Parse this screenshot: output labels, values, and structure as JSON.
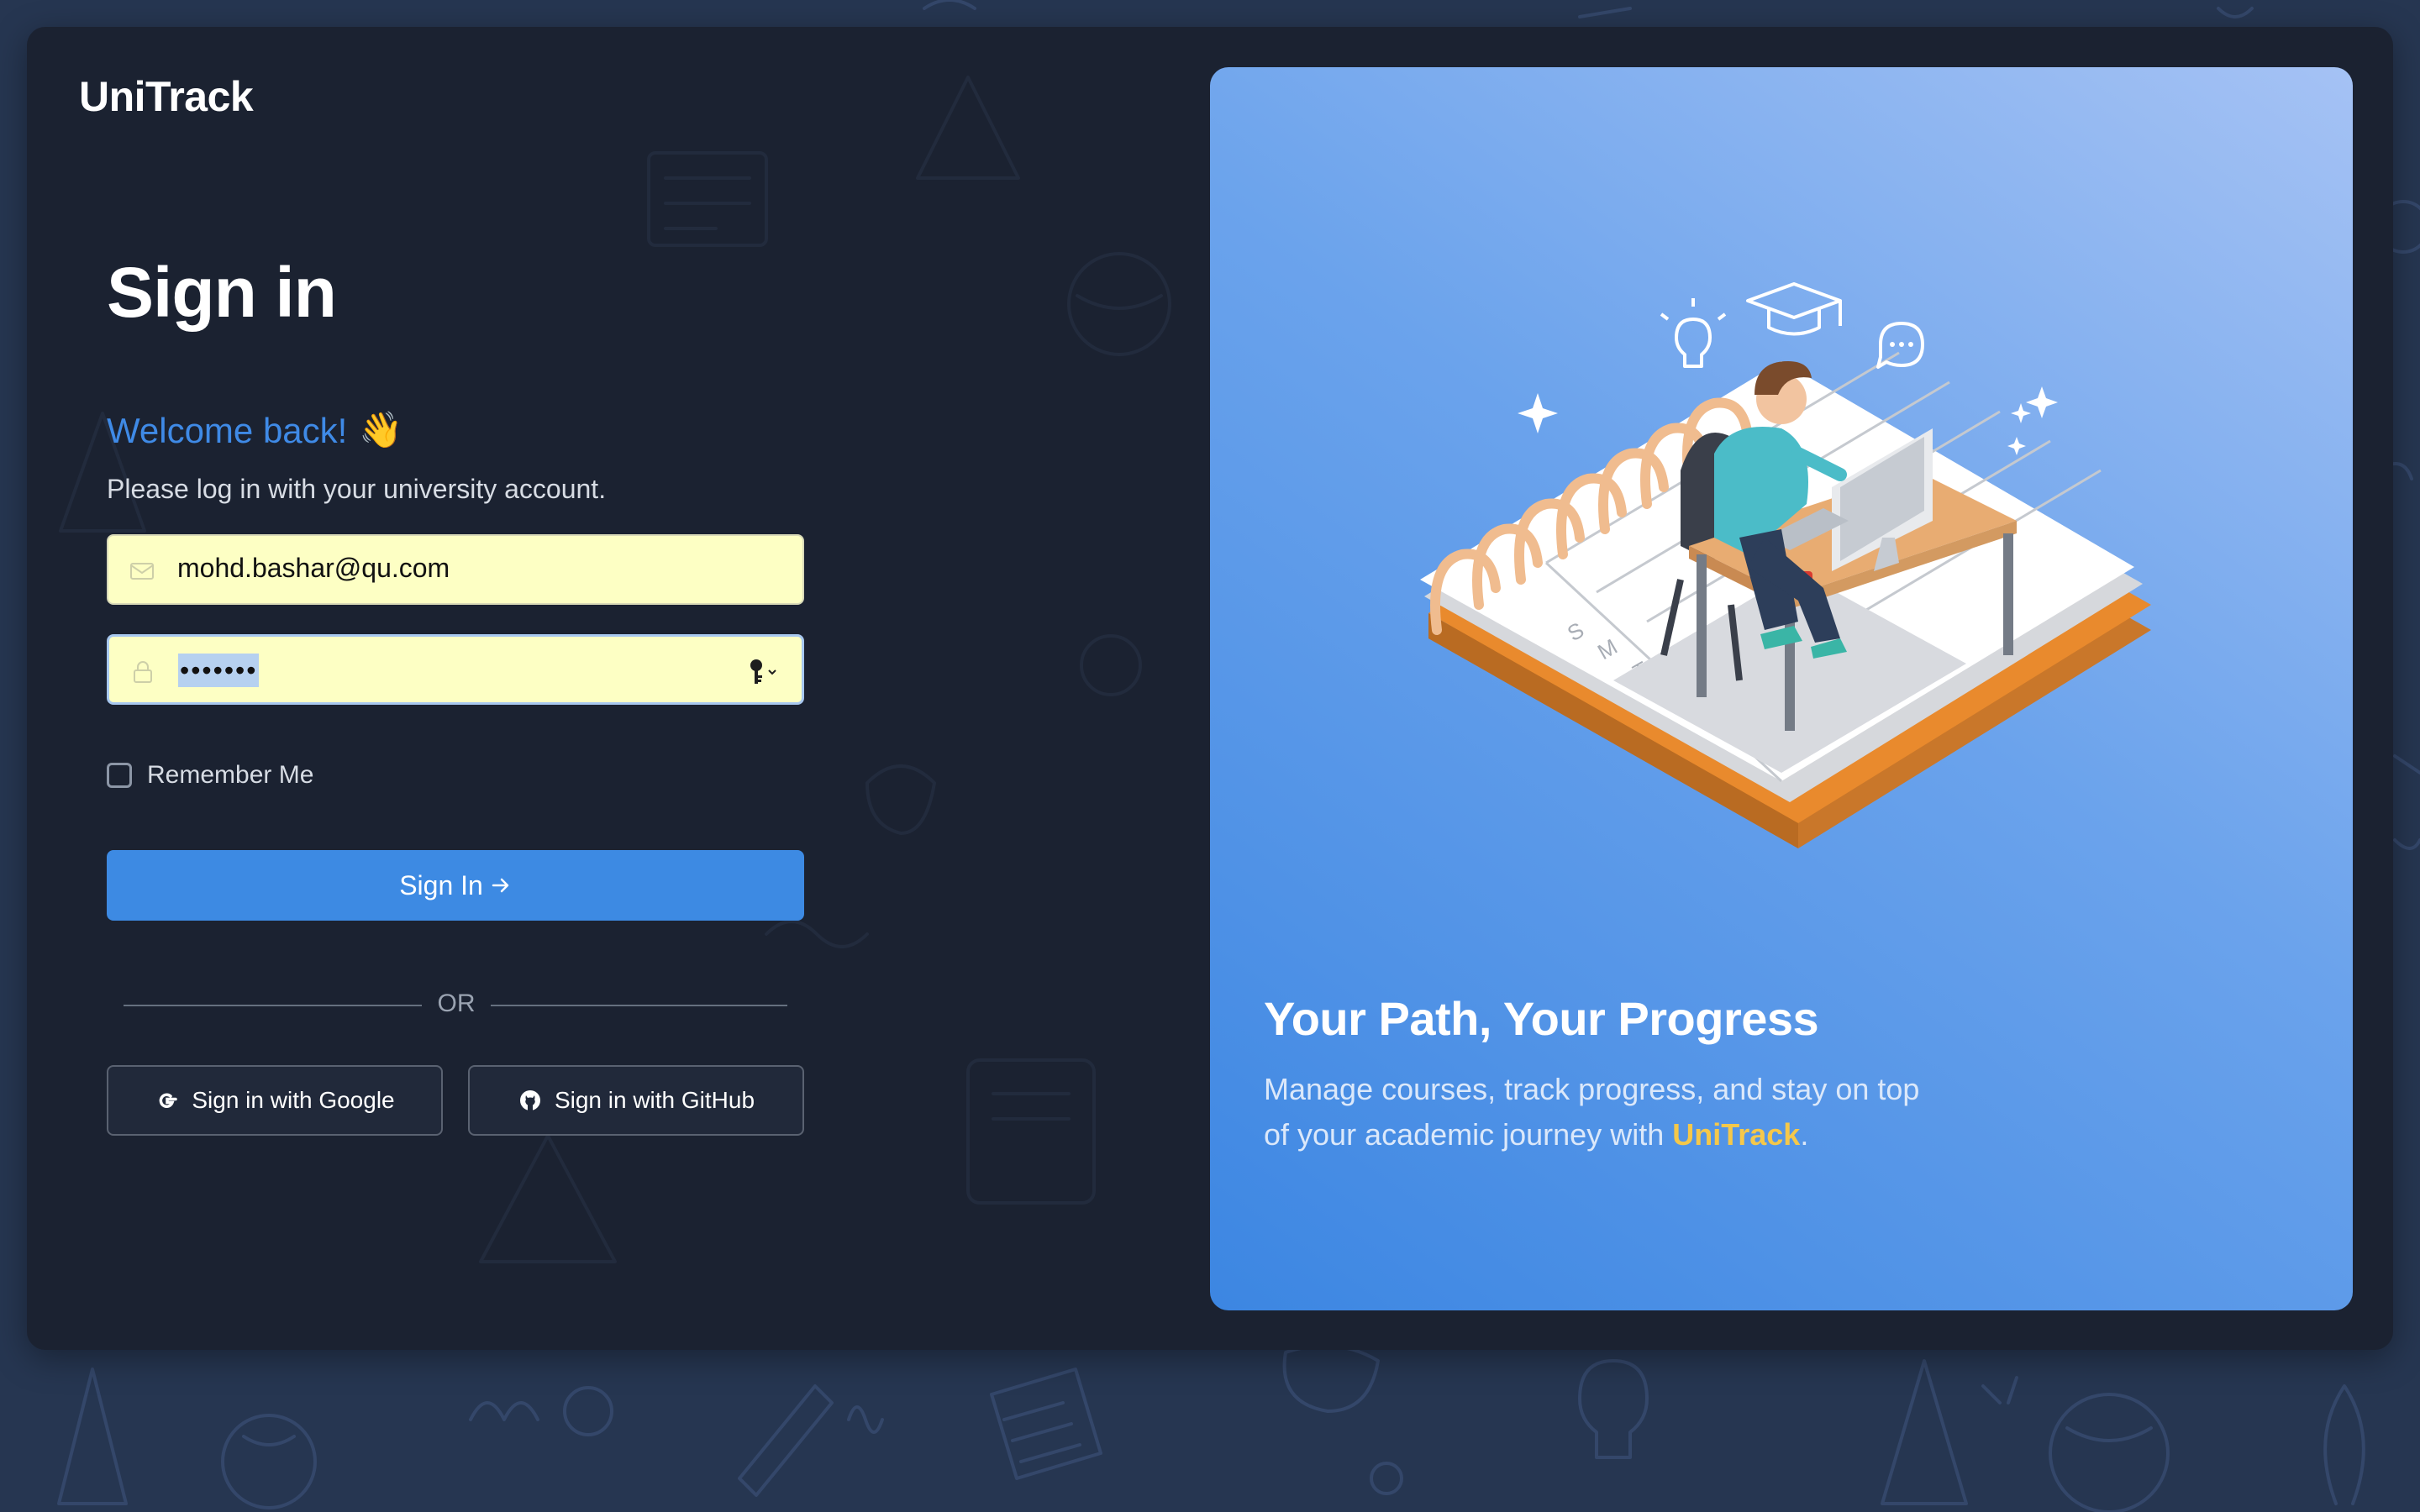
{
  "app": {
    "logo": "UniTrack"
  },
  "form": {
    "title": "Sign in",
    "welcome": "Welcome back!",
    "welcome_emoji": "👋",
    "subtitle": "Please log in with your university account.",
    "email": {
      "value": "mohd.bashar@qu.com",
      "icon": "mail-icon"
    },
    "password": {
      "value": "•••••••",
      "icon": "lock-icon",
      "autofill_icon": "key-icon"
    },
    "remember_label": "Remember Me",
    "remember_checked": false,
    "submit_label": "Sign In",
    "submit_icon": "arrow-right-icon",
    "divider_label": "OR",
    "google_label": "Sign in with Google",
    "github_label": "Sign in with GitHub"
  },
  "hero": {
    "title": "Your Path, Your Progress",
    "text_before": "Manage courses, track progress, and stay on top of your academic journey with",
    "brand": "UniTrack",
    "text_after": "."
  },
  "colors": {
    "page_background": "#263651",
    "card_background": "#1b2231",
    "accent_blue": "#3d8ae3",
    "input_fill": "#fdffc4",
    "brand_highlight": "#f5c84a"
  }
}
